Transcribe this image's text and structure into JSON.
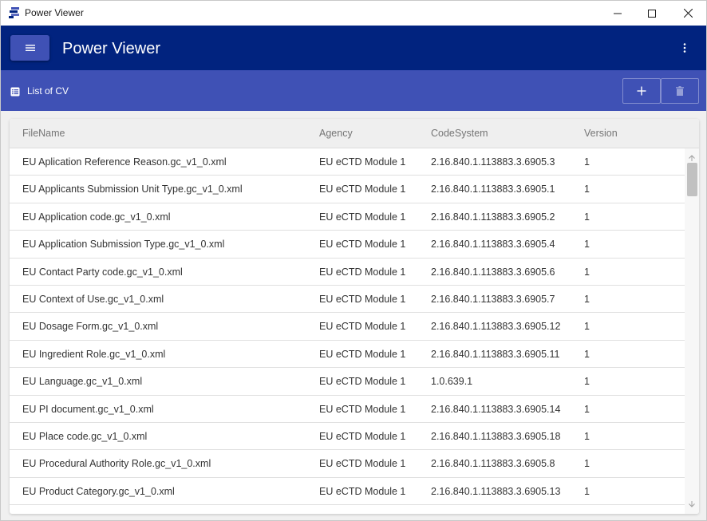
{
  "window": {
    "title": "Power Viewer"
  },
  "appbar": {
    "title": "Power Viewer",
    "menu_icon": "hamburger-icon",
    "more_icon": "more-vertical-icon"
  },
  "toolbar": {
    "title": "List of CV",
    "list_icon": "list-icon",
    "add_icon": "plus-icon",
    "delete_icon": "trash-icon"
  },
  "table": {
    "headers": {
      "filename": "FileName",
      "agency": "Agency",
      "codesystem": "CodeSystem",
      "version": "Version"
    },
    "rows": [
      {
        "filename": "EU Aplication Reference Reason.gc_v1_0.xml",
        "agency": "EU eCTD Module 1",
        "codesystem": "2.16.840.1.113883.3.6905.3",
        "version": "1"
      },
      {
        "filename": "EU Applicants Submission Unit Type.gc_v1_0.xml",
        "agency": "EU eCTD Module 1",
        "codesystem": "2.16.840.1.113883.3.6905.1",
        "version": "1"
      },
      {
        "filename": "EU Application code.gc_v1_0.xml",
        "agency": "EU eCTD Module 1",
        "codesystem": "2.16.840.1.113883.3.6905.2",
        "version": "1"
      },
      {
        "filename": "EU Application Submission Type.gc_v1_0.xml",
        "agency": "EU eCTD Module 1",
        "codesystem": "2.16.840.1.113883.3.6905.4",
        "version": "1"
      },
      {
        "filename": "EU Contact Party code.gc_v1_0.xml",
        "agency": "EU eCTD Module 1",
        "codesystem": "2.16.840.1.113883.3.6905.6",
        "version": "1"
      },
      {
        "filename": "EU Context of Use.gc_v1_0.xml",
        "agency": "EU eCTD Module 1",
        "codesystem": "2.16.840.1.113883.3.6905.7",
        "version": "1"
      },
      {
        "filename": "EU Dosage Form.gc_v1_0.xml",
        "agency": "EU eCTD Module 1",
        "codesystem": "2.16.840.1.113883.3.6905.12",
        "version": "1"
      },
      {
        "filename": "EU Ingredient Role.gc_v1_0.xml",
        "agency": "EU eCTD Module 1",
        "codesystem": "2.16.840.1.113883.3.6905.11",
        "version": "1"
      },
      {
        "filename": "EU Language.gc_v1_0.xml",
        "agency": "EU eCTD Module 1",
        "codesystem": "1.0.639.1",
        "version": "1"
      },
      {
        "filename": "EU PI document.gc_v1_0.xml",
        "agency": "EU eCTD Module 1",
        "codesystem": "2.16.840.1.113883.3.6905.14",
        "version": "1"
      },
      {
        "filename": "EU Place code.gc_v1_0.xml",
        "agency": "EU eCTD Module 1",
        "codesystem": "2.16.840.1.113883.3.6905.18",
        "version": "1"
      },
      {
        "filename": "EU Procedural Authority Role.gc_v1_0.xml",
        "agency": "EU eCTD Module 1",
        "codesystem": "2.16.840.1.113883.3.6905.8",
        "version": "1"
      },
      {
        "filename": "EU Product Category.gc_v1_0.xml",
        "agency": "EU eCTD Module 1",
        "codesystem": "2.16.840.1.113883.3.6905.13",
        "version": "1"
      }
    ]
  },
  "colors": {
    "appbar": "#01237f",
    "toolbar": "#3f51b5",
    "menu_button": "#3f51b5"
  }
}
